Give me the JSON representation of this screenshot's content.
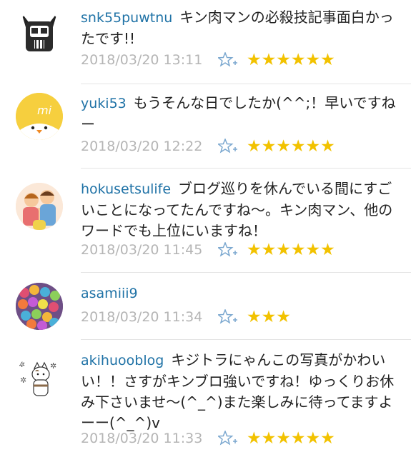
{
  "comments": [
    {
      "user": "snk55puwtnu",
      "text": "キン肉マンの必殺技記事面白かったです!!",
      "timestamp": "2018/03/20 13:11",
      "stars": "★★★★★★",
      "star_count": 6
    },
    {
      "user": "yuki53",
      "text": "もうそんな日でしたか(^^;！早いですねー",
      "timestamp": "2018/03/20 12:22",
      "stars": "★★★★★★",
      "star_count": 6
    },
    {
      "user": "hokusetsulife",
      "text": "ブログ巡りを休んでいる間にすごいことになってたんですね～。キン肉マン、他のワードでも上位にいますね！",
      "timestamp": "2018/03/20 11:45",
      "stars": "★★★★★★",
      "star_count": 6
    },
    {
      "user": "asamiii9",
      "text": "",
      "timestamp": "2018/03/20 11:34",
      "stars": "★★★",
      "star_count": 3
    },
    {
      "user": "akihuooblog",
      "text": "キジトラにゃんこの写真がかわいい！！さすがキンブロ強いですね！ゆっくりお休み下さいませ～(^_^)また楽しみに待ってますよーー(^_^)v",
      "timestamp": "2018/03/20 11:33",
      "stars": "★★★★★★",
      "star_count": 6
    }
  ],
  "icons": {
    "add_star": "add-star-icon",
    "colors": {
      "username": "#1f72a6",
      "star": "#f2c200",
      "timestamp": "#b5b5b5"
    }
  }
}
